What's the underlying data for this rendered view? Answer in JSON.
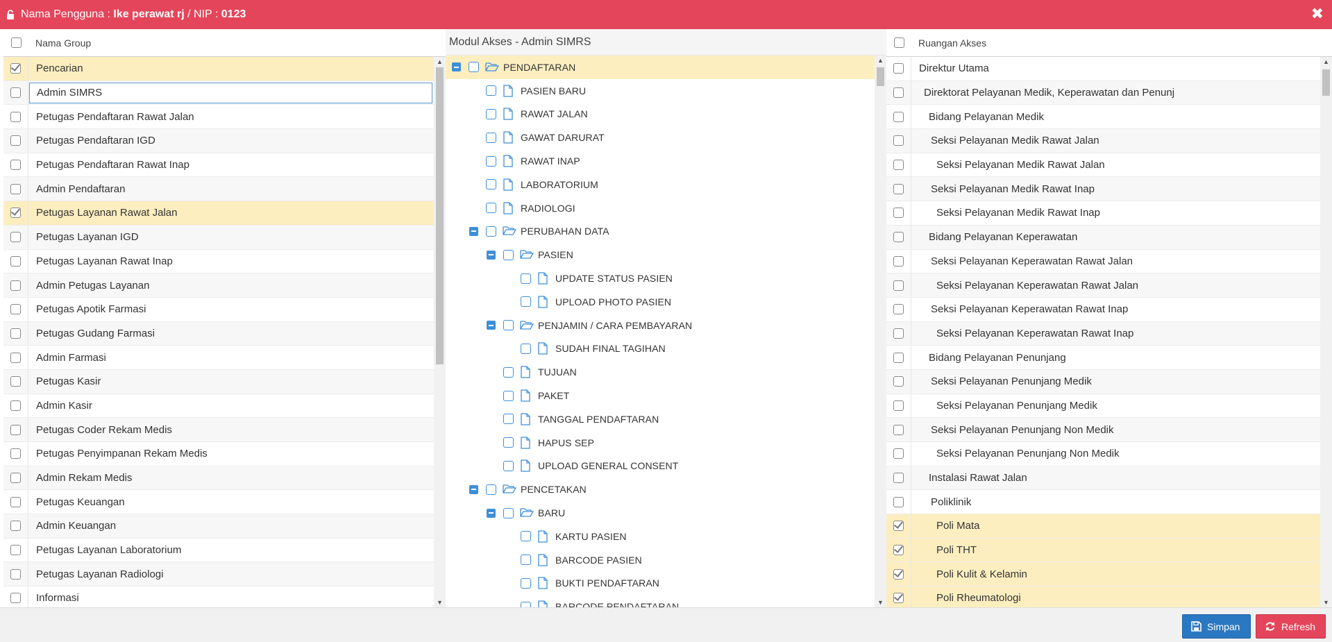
{
  "header": {
    "user_label": "Nama Pengguna : ",
    "user_name": "Ike perawat rj",
    "nip_label": " / NIP : ",
    "nip_value": "0123",
    "close_glyph": "✖"
  },
  "groups": {
    "column_header": "Nama Group",
    "items": [
      {
        "label": "Pencarian",
        "checked": true,
        "selected": true
      },
      {
        "label": "Admin SIMRS",
        "checked": false,
        "focused": true
      },
      {
        "label": "Petugas Pendaftaran Rawat Jalan",
        "checked": false
      },
      {
        "label": "Petugas Pendaftaran IGD",
        "checked": false
      },
      {
        "label": "Petugas Pendaftaran Rawat Inap",
        "checked": false
      },
      {
        "label": "Admin Pendaftaran",
        "checked": false
      },
      {
        "label": "Petugas Layanan Rawat Jalan",
        "checked": true,
        "selected": true
      },
      {
        "label": "Petugas Layanan IGD",
        "checked": false
      },
      {
        "label": "Petugas Layanan Rawat Inap",
        "checked": false
      },
      {
        "label": "Admin Petugas Layanan",
        "checked": false
      },
      {
        "label": "Petugas Apotik Farmasi",
        "checked": false
      },
      {
        "label": "Petugas Gudang Farmasi",
        "checked": false
      },
      {
        "label": "Admin Farmasi",
        "checked": false
      },
      {
        "label": "Petugas Kasir",
        "checked": false
      },
      {
        "label": "Admin Kasir",
        "checked": false
      },
      {
        "label": "Petugas Coder Rekam Medis",
        "checked": false
      },
      {
        "label": "Petugas Penyimpanan Rekam Medis",
        "checked": false
      },
      {
        "label": "Admin Rekam Medis",
        "checked": false
      },
      {
        "label": "Petugas Keuangan",
        "checked": false
      },
      {
        "label": "Admin Keuangan",
        "checked": false
      },
      {
        "label": "Petugas Layanan Laboratorium",
        "checked": false
      },
      {
        "label": "Petugas Layanan Radiologi",
        "checked": false
      },
      {
        "label": "Informasi",
        "checked": false
      }
    ]
  },
  "modules": {
    "title": "Modul Akses - Admin SIMRS",
    "nodes": [
      {
        "label": "PENDAFTARAN",
        "level": 0,
        "folder": true,
        "selected": true
      },
      {
        "label": "PASIEN BARU",
        "level": 1,
        "folder": false
      },
      {
        "label": "RAWAT JALAN",
        "level": 1,
        "folder": false
      },
      {
        "label": "GAWAT DARURAT",
        "level": 1,
        "folder": false
      },
      {
        "label": "RAWAT INAP",
        "level": 1,
        "folder": false
      },
      {
        "label": "LABORATORIUM",
        "level": 1,
        "folder": false
      },
      {
        "label": "RADIOLOGI",
        "level": 1,
        "folder": false
      },
      {
        "label": "PERUBAHAN DATA",
        "level": 1,
        "folder": true
      },
      {
        "label": "PASIEN",
        "level": 2,
        "folder": true
      },
      {
        "label": "UPDATE STATUS PASIEN",
        "level": 3,
        "folder": false
      },
      {
        "label": "UPLOAD PHOTO PASIEN",
        "level": 3,
        "folder": false
      },
      {
        "label": "PENJAMIN / CARA PEMBAYARAN",
        "level": 2,
        "folder": true
      },
      {
        "label": "SUDAH FINAL TAGIHAN",
        "level": 3,
        "folder": false
      },
      {
        "label": "TUJUAN",
        "level": 2,
        "folder": false
      },
      {
        "label": "PAKET",
        "level": 2,
        "folder": false
      },
      {
        "label": "TANGGAL PENDAFTARAN",
        "level": 2,
        "folder": false
      },
      {
        "label": "HAPUS SEP",
        "level": 2,
        "folder": false
      },
      {
        "label": "UPLOAD GENERAL CONSENT",
        "level": 2,
        "folder": false
      },
      {
        "label": "PENCETAKAN",
        "level": 1,
        "folder": true
      },
      {
        "label": "BARU",
        "level": 2,
        "folder": true
      },
      {
        "label": "KARTU PASIEN",
        "level": 3,
        "folder": false
      },
      {
        "label": "BARCODE PASIEN",
        "level": 3,
        "folder": false
      },
      {
        "label": "BUKTI PENDAFTARAN",
        "level": 3,
        "folder": false
      },
      {
        "label": "BARCODE PENDAFTARAN",
        "level": 3,
        "folder": false
      }
    ]
  },
  "rooms": {
    "column_header": "Ruangan Akses",
    "items": [
      {
        "label": "Direktur Utama",
        "indent": 0,
        "checked": false
      },
      {
        "label": "Direktorat Pelayanan Medik, Keperawatan dan Penunj",
        "indent": 1,
        "checked": false
      },
      {
        "label": "Bidang Pelayanan Medik",
        "indent": 2,
        "checked": false
      },
      {
        "label": "Seksi Pelayanan Medik Rawat Jalan",
        "indent": 3,
        "checked": false
      },
      {
        "label": "Seksi Pelayanan Medik Rawat Jalan",
        "indent": 4,
        "checked": false
      },
      {
        "label": "Seksi Pelayanan Medik Rawat Inap",
        "indent": 3,
        "checked": false
      },
      {
        "label": "Seksi Pelayanan Medik Rawat Inap",
        "indent": 4,
        "checked": false
      },
      {
        "label": "Bidang Pelayanan Keperawatan",
        "indent": 2,
        "checked": false
      },
      {
        "label": "Seksi Pelayanan Keperawatan Rawat Jalan",
        "indent": 3,
        "checked": false
      },
      {
        "label": "Seksi Pelayanan Keperawatan Rawat Jalan",
        "indent": 4,
        "checked": false
      },
      {
        "label": "Seksi Pelayanan Keperawatan Rawat Inap",
        "indent": 3,
        "checked": false
      },
      {
        "label": "Seksi Pelayanan Keperawatan Rawat Inap",
        "indent": 4,
        "checked": false
      },
      {
        "label": "Bidang Pelayanan Penunjang",
        "indent": 2,
        "checked": false
      },
      {
        "label": "Seksi Pelayanan Penunjang Medik",
        "indent": 3,
        "checked": false
      },
      {
        "label": "Seksi Pelayanan Penunjang Medik",
        "indent": 4,
        "checked": false
      },
      {
        "label": "Seksi Pelayanan Penunjang Non Medik",
        "indent": 3,
        "checked": false
      },
      {
        "label": "Seksi Pelayanan Penunjang Non Medik",
        "indent": 4,
        "checked": false
      },
      {
        "label": "Instalasi Rawat Jalan",
        "indent": 2,
        "checked": false
      },
      {
        "label": "Poliklinik",
        "indent": 3,
        "checked": false
      },
      {
        "label": "Poli Mata",
        "indent": 4,
        "checked": true,
        "selected": true
      },
      {
        "label": "Poli THT",
        "indent": 4,
        "checked": true,
        "selected": true
      },
      {
        "label": "Poli Kulit & Kelamin",
        "indent": 4,
        "checked": true,
        "selected": true
      },
      {
        "label": "Poli Rheumatologi",
        "indent": 4,
        "checked": true,
        "selected": true
      }
    ]
  },
  "footer": {
    "save_label": "Simpan",
    "refresh_label": "Refresh"
  },
  "colors": {
    "header_bg": "#e4455a",
    "selected_row": "#fdeec0",
    "tree_accent": "#3f8fd8",
    "save_button": "#2b78c2",
    "refresh_button": "#e4455a"
  }
}
